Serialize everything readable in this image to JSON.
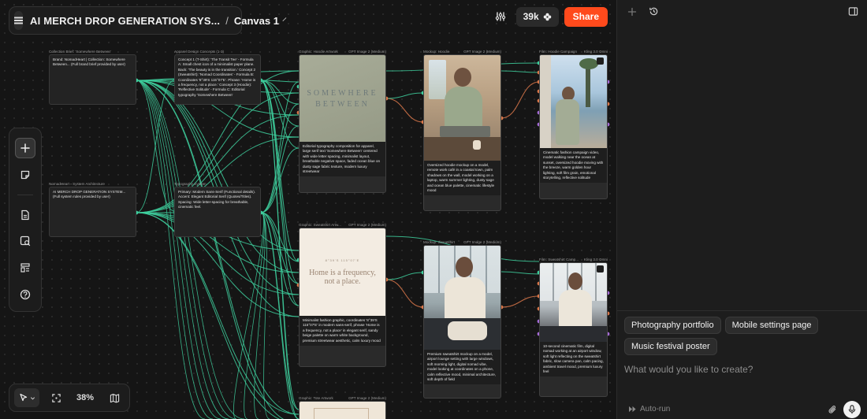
{
  "header": {
    "project_title": "AI MERCH DROP GENERATION SYS...",
    "separator": "/",
    "canvas_name": "Canvas 1",
    "credits": "39k",
    "share_label": "Share"
  },
  "left_toolbar": {
    "items": [
      "add-icon",
      "sticky-note-icon",
      "document-icon",
      "image-search-icon",
      "layout-icon",
      "help-icon"
    ]
  },
  "bottom_toolbar": {
    "zoom": "38%"
  },
  "nodes": {
    "brief": {
      "label": "Collection Brief: 'Somewhere Between'",
      "text": "Brand: NomadHeart | Collection: Somewhere Between... (Full brand brief provided by user)"
    },
    "concepts": {
      "label": "Apparel Design Concepts (1-3)",
      "text": "Concept 1 (T-Shirt): 'The Transit Tee' - Formula A: Small chest icon of a minimalist paper plane. Back: 'The beauty is in the transition.' Concept 2 (Sweatshirt): 'Nomad Coordinates' - Formula B: Coordinates '8°39'S 115°07'E'. Phrase: 'Home is a frequency, not a place.' Concept 3 (Hoodie): 'Reflective Solitude' - Formula C: Editorial typography 'Somewhere Between'"
    },
    "system": {
      "label": "NomadHeart - System Architecture",
      "text": "AI MERCH DROP GENERATION SYSTEM... (Full system rules provided by user)"
    },
    "typography": {
      "label": "Typography System",
      "text": "Primary: Modern Sans-Serif (Functional details). Accent: Elegant Editorial Serif (Quotes/Titles). Spacing: Wide letter-spacing for breathable, cinematic feel."
    },
    "hoodie_art": {
      "label": "Graphic: Hoodie Artwork",
      "model": "GPT Image 2 (Medium)",
      "art_line1": "SOMEWHERE",
      "art_line2": "BETWEEN",
      "caption": "Editorial typography composition for apparel, large serif text 'Somewhere Between' centered with wide letter spacing, minimalist layout, breathable negative space, faded ocean blue on dusty sage fabric texture, modern luxury streetwear"
    },
    "sweat_art": {
      "label": "Graphic: Sweatshirt Artw...",
      "model": "GPT Image 2 (Medium)",
      "art_small": "8°39'S 115°07'E",
      "art_line1": "Home is a frequency,",
      "art_line2": "not a place.",
      "caption": "Minimalist fashion graphic, coordinates '8°39'S 115°07'E' in modern sans-serif, phrase 'Home is a frequency, not a place' in elegant serif, sandy beige palette on warm white background, premium streetwear aesthetic, calm luxury mood"
    },
    "tote_art": {
      "label": "Graphic: Tote Artwork",
      "model": "GPT Image 2 (Medium)"
    },
    "mock_hoodie": {
      "label": "Mockup: Hoodie",
      "model": "GPT Image 2 (Medium)",
      "caption": "Oversized hoodie mockup on a model, remote work café in a coastal town, palm shadows on the wall, model working on a laptop, warm summer lighting, dusty sage and ocean blue palette, cinematic lifestyle mood"
    },
    "mock_sweat": {
      "label": "Mockup: Sweatshirt",
      "model": "GPT Image 2 (Medium)",
      "caption": "Premium sweatshirt mockup on a model, airport lounge setting with large windows, soft morning light, digital nomad vibe, model looking at coordinates on a phone, calm reflective mood, minimal architecture, soft depth of field"
    },
    "film_hoodie": {
      "label": "Film: Hoodie Campaign",
      "model": "Kling 3.0 Omni",
      "caption": "Cinematic fashion campaign video, model walking near the ocean at sunset, oversized hoodie moving with the breeze, warm golden hour lighting, soft film grain, emotional storytelling, reflective solitude"
    },
    "film_sweat": {
      "label": "Film: Sweatshirt Camp...",
      "model": "Kling 3.0 Omni",
      "caption": "10-second cinematic film, digital nomad working at an airport window, soft light reflecting on the sweatshirt fabric, slow camera pan, calm pacing, ambient travel mood, premium luxury feel"
    }
  },
  "panel": {
    "suggestions": [
      "Photography portfolio",
      "Mobile settings page",
      "Music festival poster"
    ],
    "prompt_placeholder": "What would you like to create?",
    "autorun_label": "Auto-run"
  },
  "colors": {
    "accent": "#ff4a1c",
    "wire_green": "#3ecf9e",
    "wire_orange": "#d9774a",
    "port_purple": "#a46bd6"
  }
}
